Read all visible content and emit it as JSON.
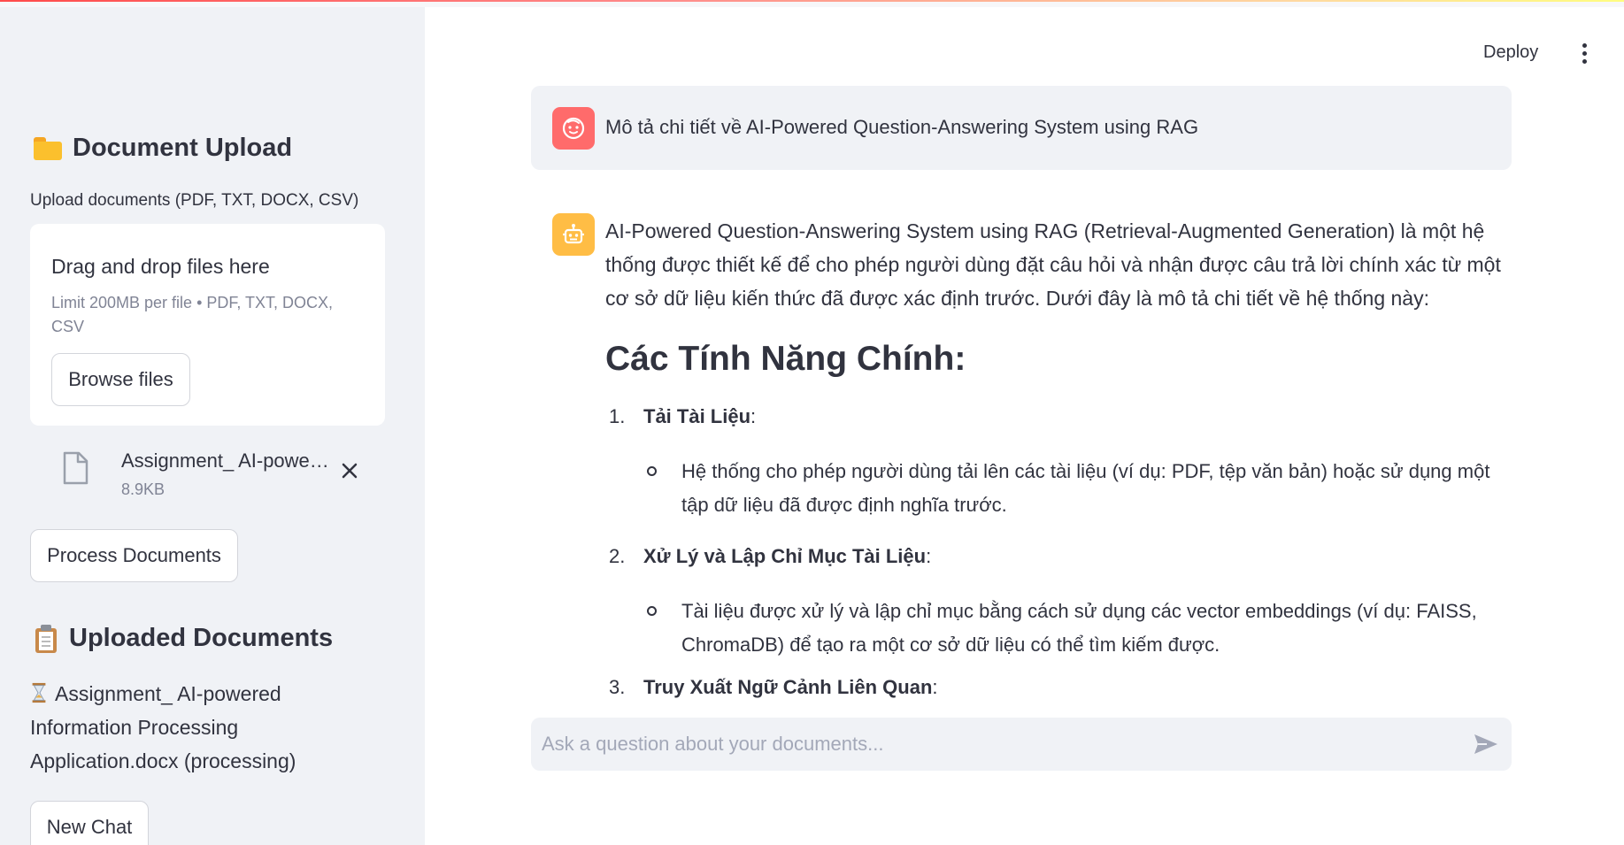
{
  "sidebar": {
    "upload_heading": "Document Upload",
    "upload_label": "Upload documents (PDF, TXT, DOCX, CSV)",
    "dropzone": {
      "title": "Drag and drop files here",
      "limit": "Limit 200MB per file • PDF, TXT, DOCX, CSV",
      "browse_label": "Browse files"
    },
    "file": {
      "name": "Assignment_ AI-powe…",
      "size": "8.9KB"
    },
    "process_label": "Process Documents",
    "uploaded_heading": "Uploaded Documents",
    "uploaded_item": "Assignment_ AI-powered Information Processing Application.docx (processing)",
    "new_chat_label": "New Chat"
  },
  "header": {
    "deploy_label": "Deploy"
  },
  "chat": {
    "user_message": "Mô tả chi tiết về AI-Powered Question-Answering System using RAG",
    "bot_intro": "AI-Powered Question-Answering System using RAG (Retrieval-Augmented Generation) là một hệ thống được thiết kế để cho phép người dùng đặt câu hỏi và nhận được câu trả lời chính xác từ một cơ sở dữ liệu kiến thức đã được xác định trước. Dưới đây là mô tả chi tiết về hệ thống này:",
    "bot_heading": "Các Tính Năng Chính:",
    "features": [
      {
        "num": "1.",
        "title": "Tải Tài Liệu",
        "desc": "Hệ thống cho phép người dùng tải lên các tài liệu (ví dụ: PDF, tệp văn bản) hoặc sử dụng một tập dữ liệu đã được định nghĩa trước."
      },
      {
        "num": "2.",
        "title": "Xử Lý và Lập Chỉ Mục Tài Liệu",
        "desc": "Tài liệu được xử lý và lập chỉ mục bằng cách sử dụng các vector embeddings (ví dụ: FAISS, ChromaDB) để tạo ra một cơ sở dữ liệu có thể tìm kiếm được."
      },
      {
        "num": "3.",
        "title": "Truy Xuất Ngữ Cảnh Liên Quan",
        "desc": ""
      }
    ],
    "input_placeholder": "Ask a question about your documents..."
  },
  "colors": {
    "sidebar_bg": "#f0f2f6",
    "user_avatar": "#ff6b6b",
    "bot_avatar": "#ffbd45",
    "text": "#31333f",
    "muted": "#808495"
  }
}
